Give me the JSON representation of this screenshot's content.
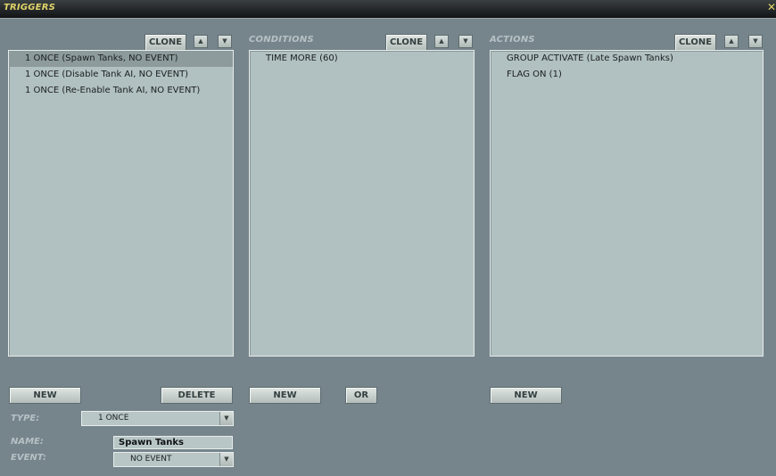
{
  "window": {
    "title": "TRIGGERS",
    "close_glyph": "✕"
  },
  "arrows": {
    "up": "▲",
    "down": "▼"
  },
  "triggers": {
    "clone_label": "CLONE",
    "items": [
      {
        "label": "1 ONCE (Spawn Tanks, NO EVENT)",
        "selected": true
      },
      {
        "label": "1 ONCE (Disable Tank AI, NO EVENT)",
        "selected": false
      },
      {
        "label": "1 ONCE (Re-Enable Tank AI, NO EVENT)",
        "selected": false
      }
    ],
    "new_label": "NEW",
    "delete_label": "DELETE"
  },
  "conditions": {
    "title": "CONDITIONS",
    "clone_label": "CLONE",
    "items": [
      {
        "label": "TIME MORE (60)"
      }
    ],
    "new_label": "NEW",
    "or_label": "OR"
  },
  "actions": {
    "title": "ACTIONS",
    "clone_label": "CLONE",
    "items": [
      {
        "label": "GROUP ACTIVATE (Late Spawn Tanks)"
      },
      {
        "label": "FLAG ON (1)"
      }
    ],
    "new_label": "NEW"
  },
  "form": {
    "type_label": "TYPE:",
    "type_value": "1 ONCE",
    "name_label": "NAME:",
    "name_value": "Spawn Tanks",
    "event_label": "EVENT:",
    "event_value": "NO EVENT"
  },
  "colors": {
    "title_text": "#e2d46a",
    "panel_bg": "#76858c",
    "list_bg": "#b1c0c0",
    "selected_bg": "#8e9b9c"
  }
}
